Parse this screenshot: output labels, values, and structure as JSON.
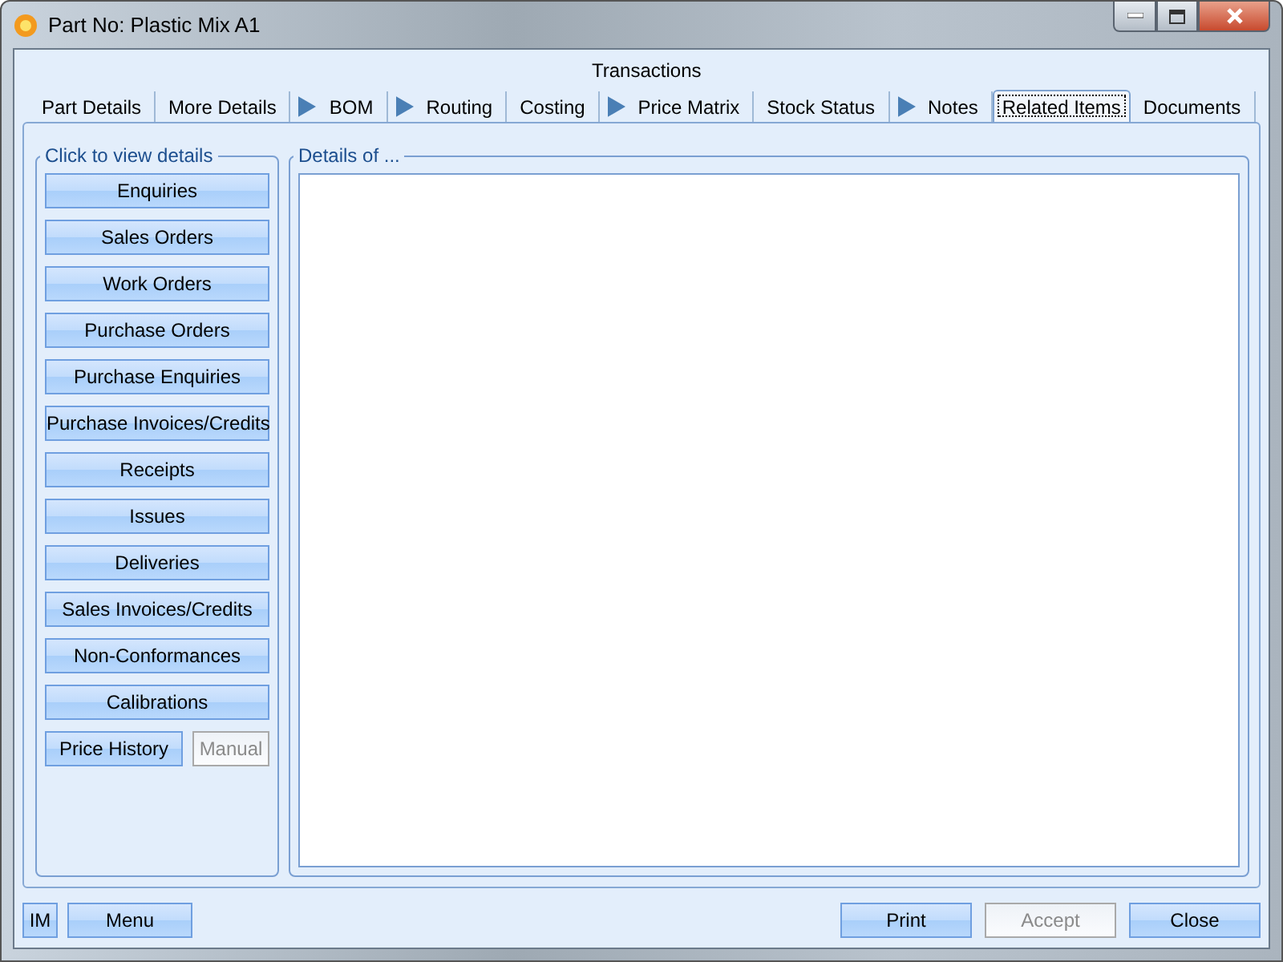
{
  "window": {
    "title": "Part No: Plastic Mix A1"
  },
  "tab_group_label": "Transactions",
  "tabs": [
    {
      "label": "Part Details",
      "arrow": false,
      "selected": false
    },
    {
      "label": "More Details",
      "arrow": false,
      "selected": false
    },
    {
      "label": "BOM",
      "arrow": true,
      "selected": false
    },
    {
      "label": "Routing",
      "arrow": true,
      "selected": false
    },
    {
      "label": "Costing",
      "arrow": false,
      "selected": false
    },
    {
      "label": "Price Matrix",
      "arrow": true,
      "selected": false
    },
    {
      "label": "Stock Status",
      "arrow": false,
      "selected": false
    },
    {
      "label": "Notes",
      "arrow": true,
      "selected": false
    },
    {
      "label": "Related Items",
      "arrow": false,
      "selected": true
    },
    {
      "label": "Documents",
      "arrow": false,
      "selected": false
    }
  ],
  "left_group": {
    "title": "Click to view details",
    "rows": [
      [
        {
          "label": "Enquiries",
          "disabled": false
        }
      ],
      [
        {
          "label": "Sales Orders",
          "disabled": false
        }
      ],
      [
        {
          "label": "Work Orders",
          "disabled": false
        }
      ],
      [
        {
          "label": "Purchase Orders",
          "disabled": false
        }
      ],
      [
        {
          "label": "Purchase Enquiries",
          "disabled": false
        }
      ],
      [
        {
          "label": "Purchase Invoices/Credits",
          "disabled": false
        }
      ],
      [
        {
          "label": "Receipts",
          "disabled": false
        }
      ],
      [
        {
          "label": "Issues",
          "disabled": false
        }
      ],
      [
        {
          "label": "Deliveries",
          "disabled": false
        }
      ],
      [
        {
          "label": "Sales Invoices/Credits",
          "disabled": false
        }
      ],
      [
        {
          "label": "Non-Conformances",
          "disabled": false
        }
      ],
      [
        {
          "label": "Calibrations",
          "disabled": false
        }
      ],
      [
        {
          "label": "Price History",
          "disabled": false
        },
        {
          "label": "Manual",
          "disabled": true
        }
      ]
    ]
  },
  "details_group": {
    "title": "Details of ..."
  },
  "bottom_left": [
    {
      "label": "IM",
      "disabled": false
    },
    {
      "label": "Menu",
      "disabled": false
    }
  ],
  "bottom_right": [
    {
      "label": "Print",
      "disabled": false
    },
    {
      "label": "Accept",
      "disabled": true
    },
    {
      "label": "Close",
      "disabled": false
    }
  ]
}
